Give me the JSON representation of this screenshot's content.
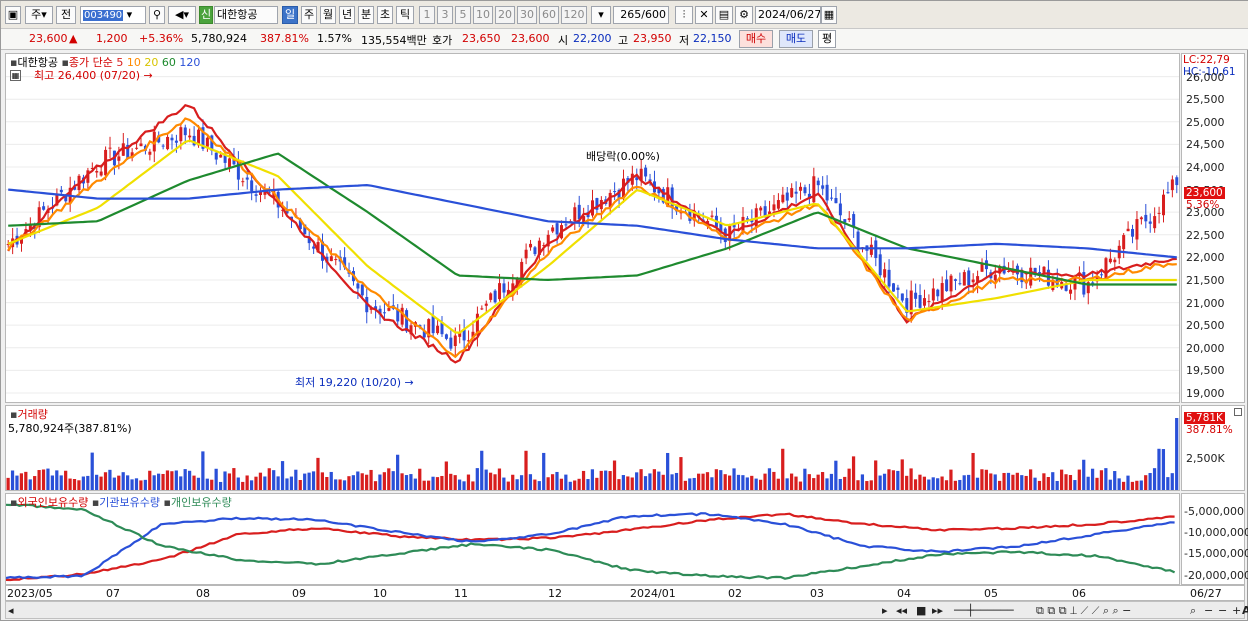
{
  "toolbar": {
    "period_label": "주",
    "prev_label": "전",
    "code": "003490",
    "stock_tag": "신",
    "stock_name": "대한항공",
    "intervals": [
      "일",
      "주",
      "월",
      "년",
      "분",
      "초",
      "틱"
    ],
    "active_interval": "일",
    "numbers": [
      "1",
      "3",
      "5",
      "10",
      "20",
      "30",
      "60",
      "120"
    ],
    "count": "265",
    "count_total": "/600",
    "date": "2024/06/27"
  },
  "quote": {
    "price": "23,600",
    "change_arrow": "▲",
    "change": "1,200",
    "change_pct": "+5.36%",
    "volume": "5,780,924",
    "volume_ratio": "387.81%",
    "turnover": "1.57%",
    "amount": "135,554백만",
    "bid_label": "호가",
    "ask_price": "23,650",
    "bid_price": "23,600",
    "open_label": "시",
    "open": "22,200",
    "high_label": "고",
    "high": "23,950",
    "low_label": "저",
    "low": "22,150",
    "buy_label": "매수",
    "sell_label": "매도",
    "eval_label": "평"
  },
  "price_panel": {
    "legend_name": "대한항공",
    "legend_ma_title": "종가 단순",
    "ma_periods": [
      "5",
      "10",
      "20",
      "60",
      "120"
    ],
    "ma_colors": [
      "#d81e1e",
      "#ff8a00",
      "#f0e000",
      "#1e8a2e",
      "#2a50d8"
    ],
    "high_note": "최고 26,400 (07/20)",
    "low_note": "최저 19,220 (10/20)",
    "dividend_note": "배당락(0.00%)",
    "lc": "LC:22,79",
    "hc": "HC:-10,61",
    "last_tag": "23,600",
    "last_pct": "5.36%",
    "y_ticks": [
      "26,000",
      "25,500",
      "25,000",
      "24,500",
      "24,000",
      "23,500",
      "23,000",
      "22,500",
      "22,000",
      "21,500",
      "21,000",
      "20,500",
      "20,000",
      "19,500",
      "19,000"
    ]
  },
  "volume_panel": {
    "title": "거래량",
    "value_text": "5,780,924주(387.81%)",
    "last_tag": "5,781K",
    "last_pct": "387.81%",
    "y_tick": "2,500K"
  },
  "holdings_panel": {
    "legend": [
      "외국인보유수량",
      "기관보유수량",
      "개인보유수량"
    ],
    "y_ticks": [
      "-5,000,000",
      "-10,000,000",
      "-15,000,000",
      "-20,000,000"
    ]
  },
  "x_axis": {
    "labels": [
      "2023/05",
      "07",
      "08",
      "09",
      "10",
      "11",
      "12",
      "2024/01",
      "02",
      "03",
      "04",
      "05",
      "06"
    ],
    "right_label": "06/27"
  },
  "chart_data": {
    "type": "candlestick",
    "ylim": [
      18800,
      26500
    ],
    "x": [
      "2023/05",
      "07",
      "08",
      "09",
      "10",
      "11",
      "12",
      "2024/01",
      "02",
      "03",
      "04",
      "05",
      "06"
    ],
    "series": [
      {
        "name": "종가",
        "values": [
          22300,
          24100,
          24800,
          23200,
          21000,
          20100,
          22600,
          23800,
          22500,
          23600,
          21000,
          21800,
          21400,
          23600
        ]
      },
      {
        "name": "5",
        "values": [
          22200,
          24000,
          25400,
          23200,
          20900,
          19700,
          22300,
          23800,
          22500,
          23400,
          20600,
          21700,
          21600,
          22000
        ]
      },
      {
        "name": "10",
        "values": [
          22200,
          23700,
          25100,
          23300,
          21300,
          19800,
          22100,
          23600,
          22400,
          23200,
          20600,
          21500,
          21500,
          21900
        ]
      },
      {
        "name": "20",
        "values": [
          22300,
          23100,
          24600,
          23800,
          21800,
          20300,
          21800,
          23500,
          22700,
          23200,
          20800,
          21100,
          21500,
          21500
        ]
      },
      {
        "name": "60",
        "values": [
          22700,
          22800,
          23700,
          24300,
          23000,
          21600,
          21500,
          21600,
          22200,
          23000,
          22200,
          21800,
          21400,
          21400
        ]
      },
      {
        "name": "120",
        "values": [
          23500,
          23300,
          23300,
          23500,
          23600,
          23200,
          22800,
          22700,
          22400,
          22200,
          22200,
          22300,
          22200,
          22000
        ]
      }
    ]
  }
}
